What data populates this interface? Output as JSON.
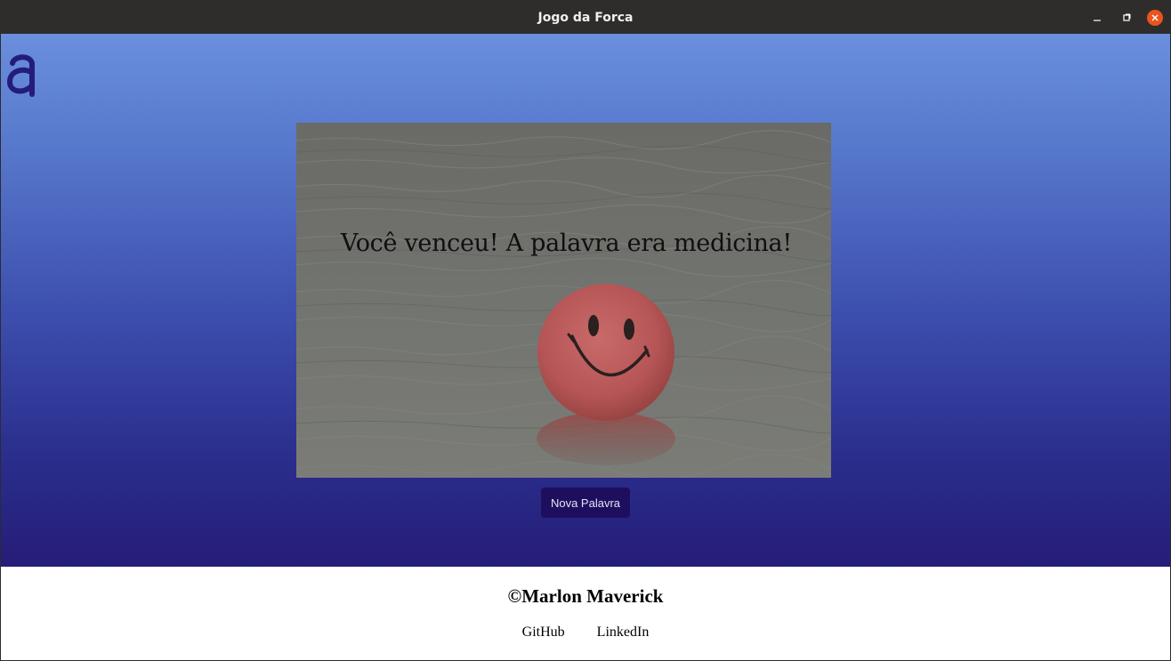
{
  "window": {
    "title": "Jogo da Forca",
    "controls": {
      "minimize_icon": "minimize-icon",
      "maximize_icon": "maximize-icon",
      "close_icon": "close-icon"
    }
  },
  "app": {
    "logo_icon": "letter-a-logo-icon",
    "result_message": "Você venceu! A palavra era medicina!",
    "result_image": "smiley-ball-in-water-image",
    "new_word_label": "Nova Palavra"
  },
  "footer": {
    "copyright": "©Marlon Maverick",
    "links": [
      {
        "label": "GitHub"
      },
      {
        "label": "LinkedIn"
      }
    ]
  },
  "colors": {
    "titlebar": "#2e2d2c",
    "gradient_top": "#6a8fdd",
    "gradient_bottom": "#251d78",
    "button_bg": "#1e0f5e",
    "close_button": "#e9541f",
    "logo": "#231c7a"
  }
}
